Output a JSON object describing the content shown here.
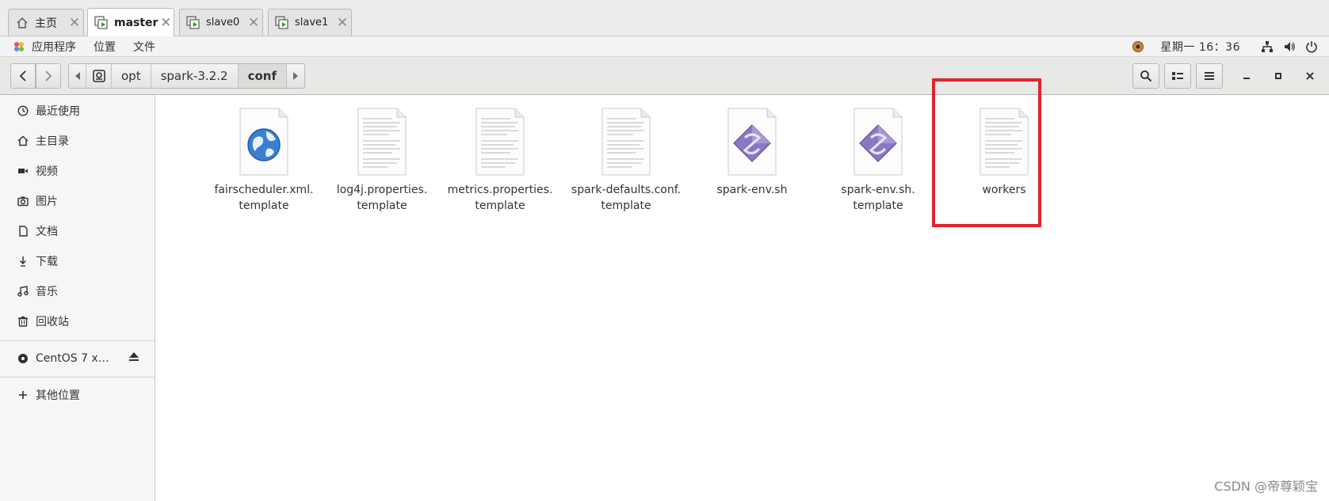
{
  "tabs": [
    {
      "label": "主页",
      "icon": "home-icon",
      "active": false
    },
    {
      "label": "master",
      "icon": "vm-icon",
      "active": true
    },
    {
      "label": "slave0",
      "icon": "vm-icon",
      "active": false
    },
    {
      "label": "slave1",
      "icon": "vm-icon",
      "active": false
    }
  ],
  "topbar": {
    "menus": [
      "应用程序",
      "位置",
      "文件"
    ],
    "clock": "星期一 16：36"
  },
  "pathbar": {
    "crumbs": [
      "opt",
      "spark-3.2.2",
      "conf"
    ]
  },
  "sidebar": {
    "items": [
      {
        "label": "最近使用",
        "icon": "clock-icon"
      },
      {
        "label": "主目录",
        "icon": "home-icon"
      },
      {
        "label": "视频",
        "icon": "video-icon"
      },
      {
        "label": "图片",
        "icon": "camera-icon"
      },
      {
        "label": "文档",
        "icon": "document-icon"
      },
      {
        "label": "下载",
        "icon": "download-icon"
      },
      {
        "label": "音乐",
        "icon": "music-icon"
      },
      {
        "label": "回收站",
        "icon": "trash-icon"
      }
    ],
    "device": {
      "label": "CentOS 7 x…",
      "icon": "disc-icon"
    },
    "other": {
      "label": "其他位置",
      "icon": "plus-icon"
    }
  },
  "files": [
    {
      "line1": "fairscheduler.xml.",
      "line2": "template",
      "type": "web"
    },
    {
      "line1": "log4j.properties.",
      "line2": "template",
      "type": "text"
    },
    {
      "line1": "metrics.properties.",
      "line2": "template",
      "type": "text"
    },
    {
      "line1": "spark-defaults.conf.",
      "line2": "template",
      "type": "text"
    },
    {
      "line1": "spark-env.sh",
      "line2": "",
      "type": "script"
    },
    {
      "line1": "spark-env.sh.",
      "line2": "template",
      "type": "script"
    },
    {
      "line1": "workers",
      "line2": "",
      "type": "text"
    }
  ],
  "highlight_color": "#e0232e",
  "watermark": "CSDN @帝尊颖宝"
}
